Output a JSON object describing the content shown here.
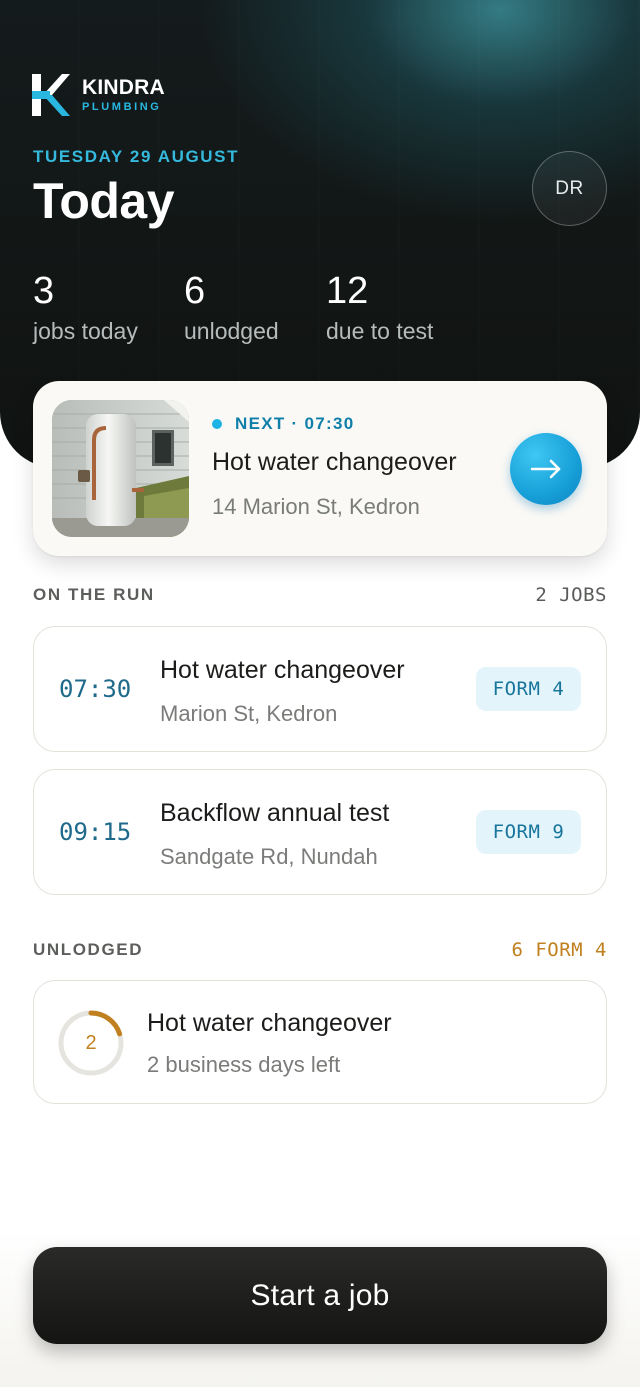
{
  "brand": {
    "name": "KINDRA",
    "subtitle": "PLUMBING"
  },
  "header": {
    "date": "TUESDAY 29 AUGUST",
    "title": "Today",
    "avatar_initials": "DR",
    "stats": [
      {
        "value": "3",
        "label": "jobs today"
      },
      {
        "value": "6",
        "label": "unlodged"
      },
      {
        "value": "12",
        "label": "due to test"
      }
    ]
  },
  "next_job": {
    "tag": "NEXT · 07:30",
    "title": "Hot water changeover",
    "address": "14 Marion St, Kedron",
    "go_icon": "arrow-right-icon"
  },
  "on_the_run": {
    "label": "ON THE RUN",
    "count": "2 JOBS",
    "jobs": [
      {
        "time": "07:30",
        "title": "Hot water changeover",
        "address": "Marion St, Kedron",
        "form": "FORM 4"
      },
      {
        "time": "09:15",
        "title": "Backflow annual test",
        "address": "Sandgate Rd, Nundah",
        "form": "FORM 9"
      }
    ]
  },
  "unlodged": {
    "label": "UNLODGED",
    "count": "6 FORM 4",
    "items": [
      {
        "days": "2",
        "title": "Hot water changeover",
        "subtitle": "2 business days left",
        "progress": 0.2
      }
    ]
  },
  "cta": {
    "label": "Start a job"
  },
  "colors": {
    "accent": "#1db4e4",
    "accent_dark": "#0f7faa",
    "warning": "#c0801f",
    "header_bg": "#121615"
  }
}
